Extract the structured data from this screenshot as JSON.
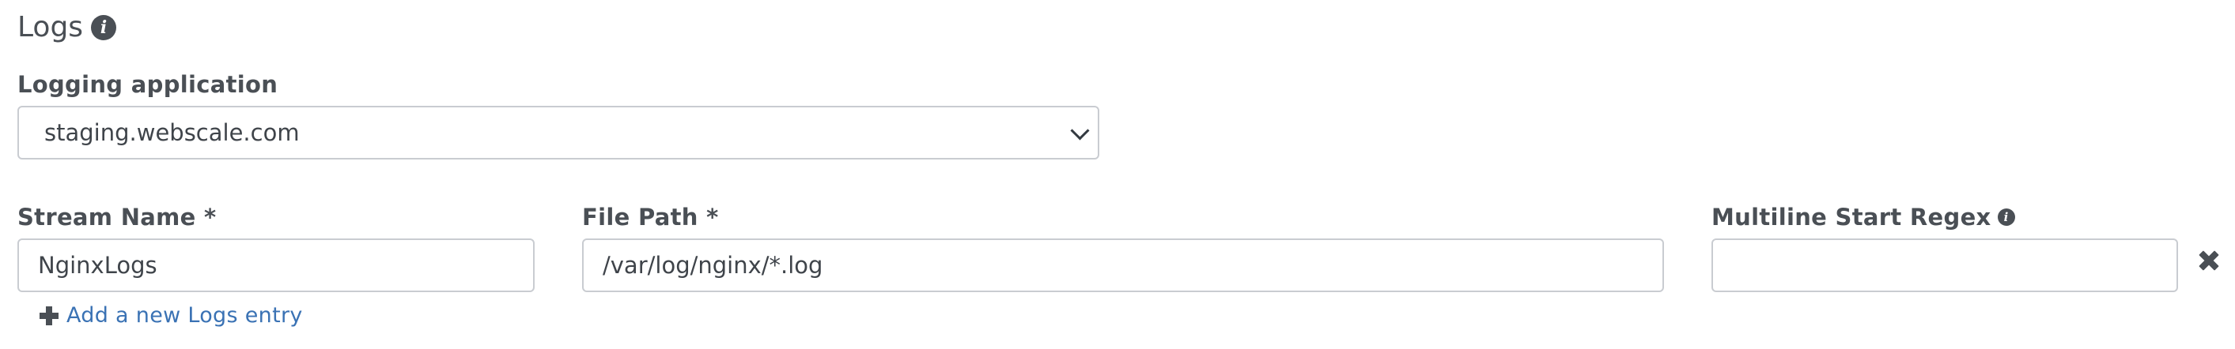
{
  "section": {
    "title": "Logs",
    "info_icon": "info-circle-icon"
  },
  "logging_application": {
    "label": "Logging application",
    "selected": "staging.webscale.com"
  },
  "entry": {
    "stream_name": {
      "label": "Stream Name *",
      "value": "NginxLogs"
    },
    "file_path": {
      "label": "File Path *",
      "value": "/var/log/nginx/*.log"
    },
    "multiline_start_regex": {
      "label": "Multiline Start Regex",
      "value": "",
      "info_icon": "info-circle-icon"
    },
    "remove_icon": "close-x-icon"
  },
  "add_entry": {
    "label": "Add a new Logs entry",
    "icon": "plus-icon"
  },
  "colors": {
    "text": "#4a4f55",
    "link": "#3a72b4",
    "border": "#c9ccd1"
  }
}
